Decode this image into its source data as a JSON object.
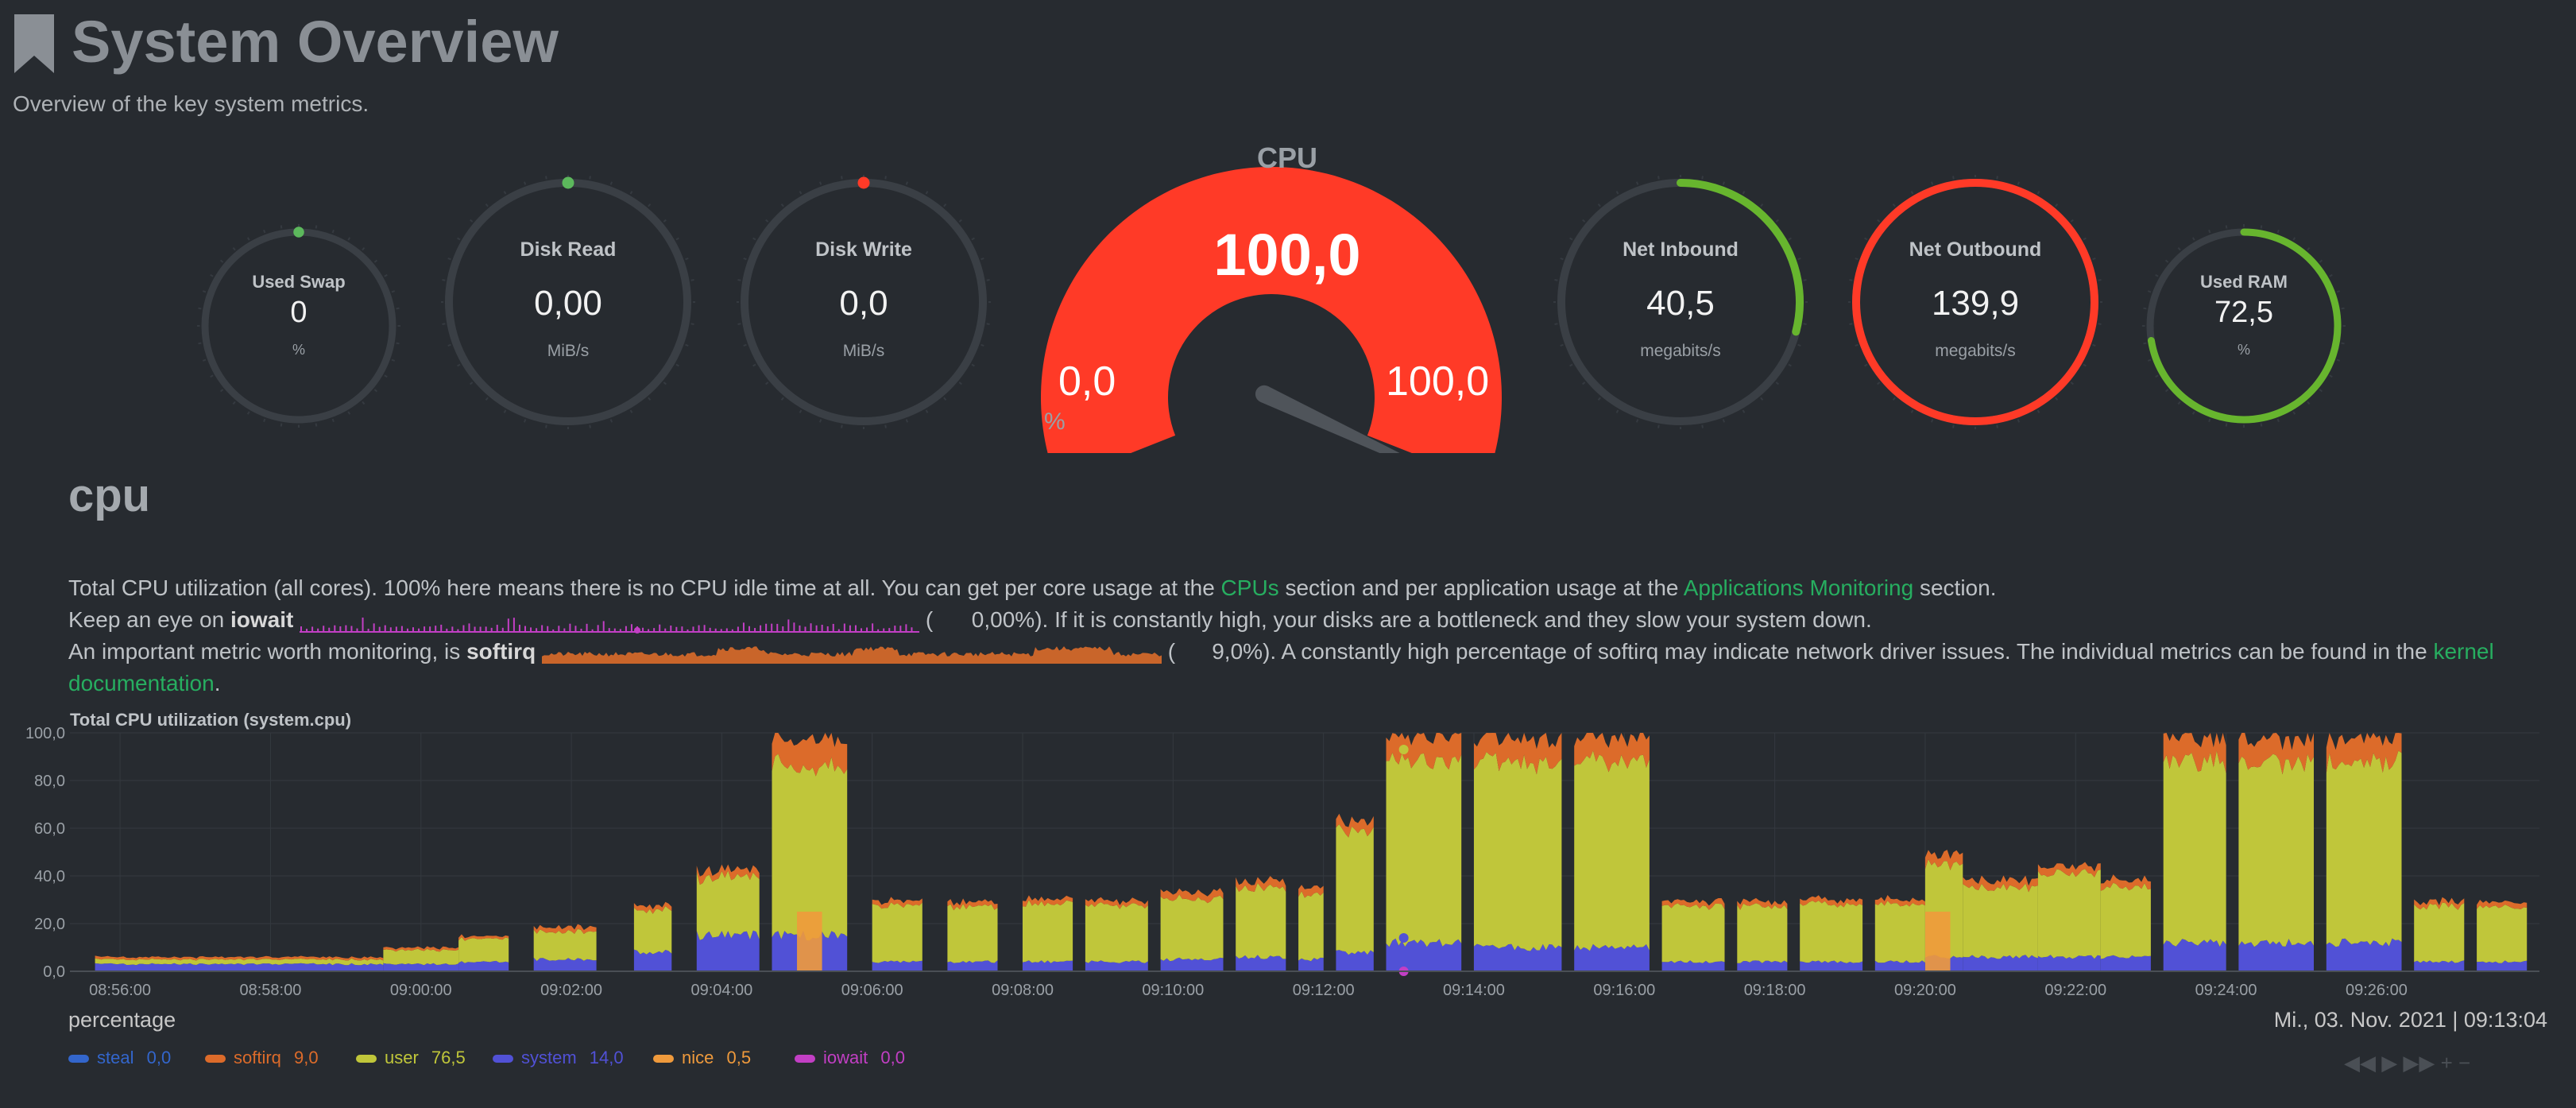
{
  "header": {
    "title": "System Overview",
    "subtitle": "Overview of the key system metrics."
  },
  "gauges": {
    "used_swap": {
      "label": "Used Swap",
      "value": "0",
      "unit": "%",
      "fraction": 0.0,
      "color": "#5cb85c"
    },
    "disk_read": {
      "label": "Disk Read",
      "value": "0,00",
      "unit": "MiB/s",
      "fraction": 0.0,
      "color": "#5cb85c"
    },
    "disk_write": {
      "label": "Disk Write",
      "value": "0,0",
      "unit": "MiB/s",
      "fraction": 0.0,
      "color": "#ff3a27"
    },
    "net_inbound": {
      "label": "Net Inbound",
      "value": "40,5",
      "unit": "megabits/s",
      "fraction": 0.29,
      "color": "#67b52e"
    },
    "net_outbound": {
      "label": "Net Outbound",
      "value": "139,9",
      "unit": "megabits/s",
      "fraction": 1.0,
      "color": "#ff3a27"
    },
    "used_ram": {
      "label": "Used RAM",
      "value": "72,5",
      "unit": "%",
      "fraction": 0.725,
      "color": "#67b52e"
    }
  },
  "cpu_gauge": {
    "label": "CPU",
    "value": "100,0",
    "min": "0,0",
    "max": "100,0",
    "unit": "%",
    "fraction": 1.0,
    "color": "#ff3a27"
  },
  "section": {
    "title": "cpu",
    "line1_a": "Total CPU utilization (all cores). 100% here means there is no CPU idle time at all. You can get per core usage at the ",
    "line1_link1": "CPUs",
    "line1_b": " section and per application usage at the ",
    "line1_link2": "Applications Monitoring",
    "line1_c": " section.",
    "line2_a": "Keep an eye on ",
    "line2_bold": "iowait",
    "line2_value": "0,00%",
    "line2_b": "). If it is constantly high, your disks are a bottleneck and they slow your system down.",
    "line3_a": "An important metric worth monitoring, is ",
    "line3_bold": "softirq",
    "line3_value": "9,0%",
    "line3_b": "). A constantly high percentage of softirq may indicate network driver issues. The individual metrics can be found in the ",
    "line3_link": "kernel",
    "line4_link": "documentation",
    "line4_b": "."
  },
  "chart": {
    "title": "Total CPU utilization (system.cpu)",
    "units": "percentage",
    "date": "Mi., 03. Nov. 2021 | 09:13:04",
    "controls": "◀◀ ▶ ▶▶ + −"
  },
  "chart_data": {
    "type": "area",
    "title": "Total CPU utilization (system.cpu)",
    "ylabel": "percentage",
    "ylim": [
      0,
      100
    ],
    "yticks": [
      "0,0",
      "20,0",
      "40,0",
      "60,0",
      "80,0",
      "100,0"
    ],
    "xticks": [
      "08:56:00",
      "08:58:00",
      "09:00:00",
      "09:02:00",
      "09:04:00",
      "09:06:00",
      "09:08:00",
      "09:10:00",
      "09:12:00",
      "09:14:00",
      "09:16:00",
      "09:18:00",
      "09:20:00",
      "09:22:00",
      "09:24:00",
      "09:26:00"
    ],
    "grid": true,
    "legend_position": "bottom-left",
    "series": [
      {
        "name": "steal",
        "current": "0,0",
        "color": "#3366cc"
      },
      {
        "name": "softirq",
        "current": "9,0",
        "color": "#dc6b2a"
      },
      {
        "name": "user",
        "current": "76,5",
        "color": "#c0c63a"
      },
      {
        "name": "system",
        "current": "14,0",
        "color": "#5151d6"
      },
      {
        "name": "nice",
        "current": "0,5",
        "color": "#ef9a3c"
      },
      {
        "name": "iowait",
        "current": "0,0",
        "color": "#c23fc4"
      }
    ],
    "segments": [
      {
        "start": "08:55:40",
        "end": "08:59:30",
        "user": 2,
        "system": 3,
        "softirq": 1
      },
      {
        "start": "08:59:30",
        "end": "09:00:30",
        "user": 6,
        "system": 3,
        "softirq": 1
      },
      {
        "start": "09:00:30",
        "end": "09:01:10",
        "user": 10,
        "system": 4,
        "softirq": 1
      },
      {
        "start": "09:01:30",
        "end": "09:02:20",
        "user": 12,
        "system": 5,
        "softirq": 2
      },
      {
        "start": "09:02:50",
        "end": "09:03:20",
        "user": 18,
        "system": 8,
        "softirq": 2
      },
      {
        "start": "09:03:40",
        "end": "09:04:30",
        "user": 25,
        "system": 15,
        "softirq": 3
      },
      {
        "start": "09:04:40",
        "end": "09:05:40",
        "user": 73,
        "system": 15,
        "softirq": 12
      },
      {
        "start": "09:06:00",
        "end": "09:06:40",
        "user": 24,
        "system": 4,
        "softirq": 2
      },
      {
        "start": "09:07:00",
        "end": "09:07:40",
        "user": 24,
        "system": 4,
        "softirq": 2
      },
      {
        "start": "09:08:00",
        "end": "09:08:40",
        "user": 25,
        "system": 4,
        "softirq": 2
      },
      {
        "start": "09:08:50",
        "end": "09:09:40",
        "user": 24,
        "system": 4,
        "softirq": 2
      },
      {
        "start": "09:09:50",
        "end": "09:10:40",
        "user": 26,
        "system": 5,
        "softirq": 3
      },
      {
        "start": "09:10:50",
        "end": "09:11:30",
        "user": 30,
        "system": 6,
        "softirq": 3
      },
      {
        "start": "09:11:40",
        "end": "09:12:00",
        "user": 28,
        "system": 5,
        "softirq": 3
      },
      {
        "start": "09:12:10",
        "end": "09:12:40",
        "user": 52,
        "system": 8,
        "softirq": 4
      },
      {
        "start": "09:12:50",
        "end": "09:13:50",
        "user": 78,
        "system": 12,
        "softirq": 10
      },
      {
        "start": "09:14:00",
        "end": "09:15:10",
        "user": 80,
        "system": 10,
        "softirq": 10
      },
      {
        "start": "09:15:20",
        "end": "09:16:20",
        "user": 80,
        "system": 10,
        "softirq": 10
      },
      {
        "start": "09:16:30",
        "end": "09:17:20",
        "user": 24,
        "system": 4,
        "softirq": 2
      },
      {
        "start": "09:17:30",
        "end": "09:18:10",
        "user": 24,
        "system": 4,
        "softirq": 2
      },
      {
        "start": "09:18:20",
        "end": "09:19:10",
        "user": 25,
        "system": 4,
        "softirq": 2
      },
      {
        "start": "09:19:20",
        "end": "09:20:00",
        "user": 25,
        "system": 4,
        "softirq": 2
      },
      {
        "start": "09:20:00",
        "end": "09:20:30",
        "user": 40,
        "system": 6,
        "softirq": 4
      },
      {
        "start": "09:20:30",
        "end": "09:21:30",
        "user": 30,
        "system": 6,
        "softirq": 3
      },
      {
        "start": "09:21:30",
        "end": "09:22:20",
        "user": 36,
        "system": 6,
        "softirq": 3
      },
      {
        "start": "09:22:20",
        "end": "09:23:00",
        "user": 30,
        "system": 6,
        "softirq": 3
      },
      {
        "start": "09:23:10",
        "end": "09:24:00",
        "user": 78,
        "system": 12,
        "softirq": 10
      },
      {
        "start": "09:24:10",
        "end": "09:25:10",
        "user": 78,
        "system": 12,
        "softirq": 10
      },
      {
        "start": "09:25:20",
        "end": "09:26:20",
        "user": 78,
        "system": 12,
        "softirq": 10
      },
      {
        "start": "09:26:30",
        "end": "09:27:10",
        "user": 24,
        "system": 4,
        "softirq": 2
      },
      {
        "start": "09:27:20",
        "end": "09:28:00",
        "user": 24,
        "system": 4,
        "softirq": 2
      }
    ]
  }
}
